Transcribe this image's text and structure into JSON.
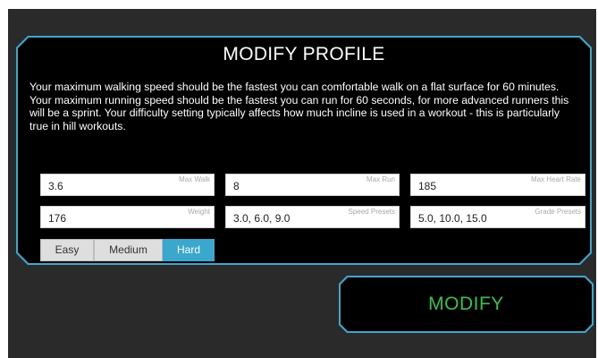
{
  "dialog": {
    "title": "MODIFY PROFILE",
    "description": "Your maximum walking speed should be the fastest you can comfortable walk on a flat surface for 60 minutes. Your maximum running speed should be the fastest you can run for 60 seconds, for more advanced runners this will be a sprint. Your difficulty setting typically affects how much incline is used in a workout - this is particularly true in hill workouts."
  },
  "fields": {
    "max_walk": {
      "value": "3.6",
      "label": "Max Walk"
    },
    "max_run": {
      "value": "8",
      "label": "Max Run"
    },
    "max_heart_rate": {
      "value": "185",
      "label": "Max Heart Rate"
    },
    "weight": {
      "value": "176",
      "label": "Weight"
    },
    "speed_presets": {
      "value": "3.0, 6.0, 9.0",
      "label": "Speed Presets"
    },
    "grade_presets": {
      "value": "5.0, 10.0, 15.0",
      "label": "Grade Presets"
    }
  },
  "difficulty": {
    "options": [
      "Easy",
      "Medium",
      "Hard"
    ],
    "selected": "Hard"
  },
  "actions": {
    "modify_label": "MODIFY"
  },
  "colors": {
    "accent": "#3aa7cf",
    "modify_text": "#34c34a",
    "background": "#2a2a2a",
    "panel": "#000000"
  }
}
